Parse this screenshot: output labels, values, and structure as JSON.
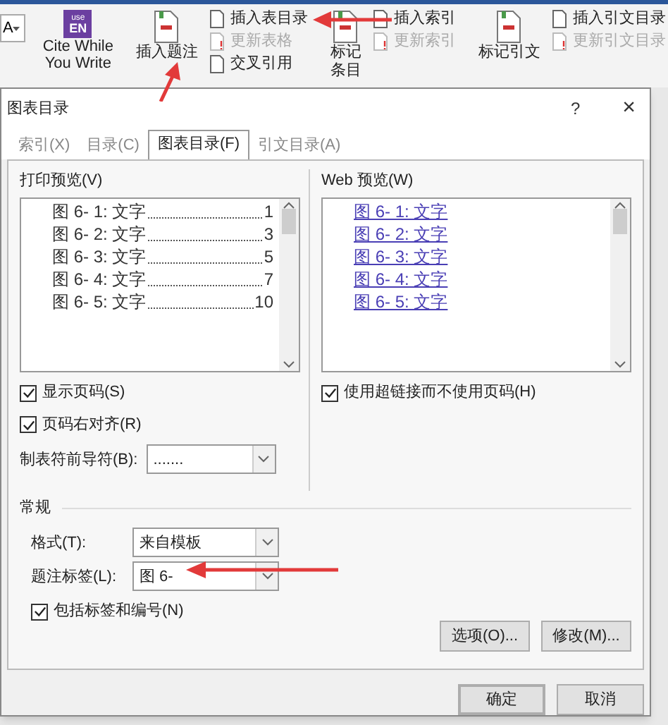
{
  "ribbon": {
    "font_dropdown": {
      "value": "A"
    },
    "items": [
      {
        "kind": "logo",
        "logo_top": "use",
        "logo_bottom": "EN",
        "lines": [
          "Cite While",
          "You Write"
        ]
      },
      {
        "kind": "large",
        "lines": [
          "插入题注"
        ]
      },
      {
        "kind": "column",
        "entries": [
          {
            "label": "插入表目录",
            "disabled": false
          },
          {
            "label": "更新表格",
            "disabled": true
          },
          {
            "label": "交叉引用",
            "disabled": false
          }
        ]
      },
      {
        "kind": "large",
        "lines": [
          "标记",
          "条目"
        ]
      },
      {
        "kind": "column",
        "entries": [
          {
            "label": "插入索引",
            "disabled": false
          },
          {
            "label": "更新索引",
            "disabled": true
          }
        ]
      },
      {
        "kind": "large",
        "lines": [
          "标记引文"
        ]
      },
      {
        "kind": "column",
        "entries": [
          {
            "label": "插入引文目录",
            "disabled": false
          },
          {
            "label": "更新引文目录",
            "disabled": true
          }
        ]
      }
    ]
  },
  "dialog": {
    "title": "图表目录",
    "help": "?",
    "close": "×",
    "tabs": [
      {
        "label": "索引(X)",
        "selected": false
      },
      {
        "label": "目录(C)",
        "selected": false
      },
      {
        "label": "图表目录(F)",
        "selected": true
      },
      {
        "label": "引文目录(A)",
        "selected": false
      }
    ],
    "print_preview": {
      "label": "打印预览(V)",
      "entries": [
        {
          "caption": "图 6- 1: 文字",
          "page": "1"
        },
        {
          "caption": "图 6- 2: 文字",
          "page": "3"
        },
        {
          "caption": "图 6- 3: 文字",
          "page": "5"
        },
        {
          "caption": "图 6- 4: 文字",
          "page": "7"
        },
        {
          "caption": "图 6- 5: 文字",
          "page": "10"
        }
      ]
    },
    "web_preview": {
      "label": "Web 预览(W)",
      "entries": [
        "图 6- 1: 文字",
        "图 6- 2: 文字",
        "图 6- 3: 文字",
        "图 6- 4: 文字",
        "图 6- 5: 文字"
      ]
    },
    "left_checks": [
      {
        "label": "显示页码(S)",
        "checked": true
      },
      {
        "label": "页码右对齐(R)",
        "checked": true
      }
    ],
    "tab_leader": {
      "label": "制表符前导符(B):",
      "value": "......."
    },
    "web_check": {
      "label": "使用超链接而不使用页码(H)",
      "checked": true
    },
    "general": {
      "title": "常规",
      "fields": [
        {
          "label": "格式(T):",
          "value": "来自模板"
        },
        {
          "label": "题注标签(L):",
          "value": "图 6-"
        }
      ],
      "check": {
        "label": "包括标签和编号(N)",
        "checked": true
      }
    },
    "panel_buttons": [
      "选项(O)...",
      "修改(M)..."
    ],
    "footer_buttons": [
      {
        "label": "确定",
        "default": true
      },
      {
        "label": "取消",
        "default": false
      }
    ]
  }
}
